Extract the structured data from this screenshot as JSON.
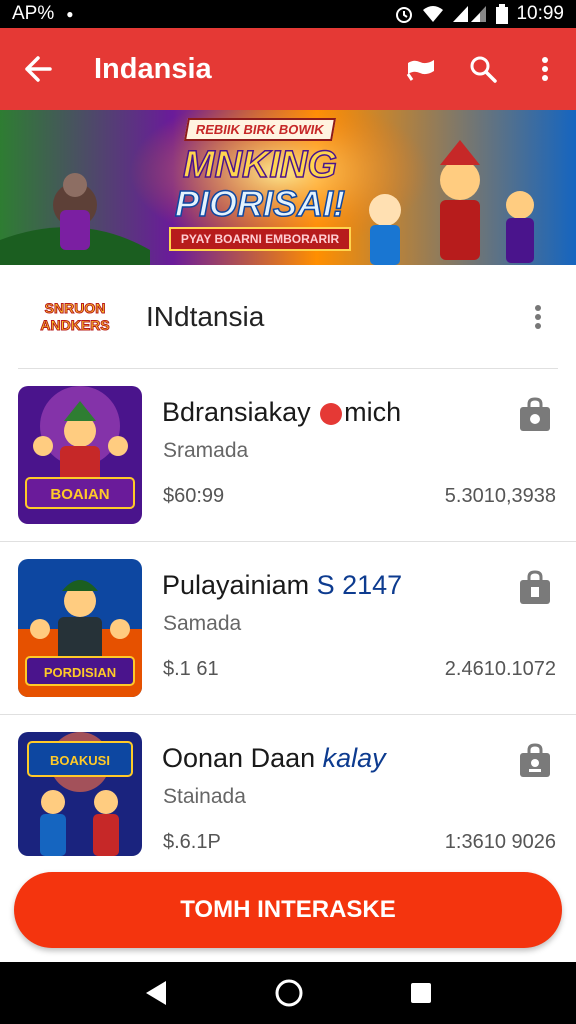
{
  "status_bar": {
    "left_text": "AP%",
    "time": "10:99"
  },
  "app_bar": {
    "title": "Indansia"
  },
  "banner": {
    "top_tag": "REBIIK BIRK BOWIK",
    "headline": "MNKING",
    "subline": "PIORISAI!",
    "ribbon": "PYAY BOARNI EMBORARIR"
  },
  "section": {
    "logo_line1": "SNRUON",
    "logo_line2": "ANDKERS",
    "title": "INdtansia"
  },
  "items": [
    {
      "title_main": "Bdransiakay",
      "title_extra": "mich",
      "subtitle": "Sramada",
      "price": "$60:99",
      "value": "5.3010,3938",
      "thumb_text": "BOAIAN"
    },
    {
      "title_main": "Pulayainiam",
      "title_extra": "S 2147",
      "subtitle": "Samada",
      "price": "$.1 61",
      "value": "2.4610.1072",
      "thumb_text": "PORDISIAN"
    },
    {
      "title_main": "Oonan Daan",
      "title_extra": "kalay",
      "subtitle": "Stainada",
      "price": "$.6.1P",
      "value": "1:3610 9026",
      "thumb_text": "BOAKUSI"
    }
  ],
  "cta": {
    "label": "TOMH INTERASKE"
  },
  "colors": {
    "app_bar": "#e53935",
    "cta": "#f4340e",
    "accent_blue": "#0d3b8f"
  },
  "icons": [
    "back-arrow-icon",
    "label-icon",
    "search-icon",
    "more-vert-icon",
    "shopping-bag-icon",
    "back-nav-icon",
    "home-nav-icon",
    "recents-nav-icon"
  ]
}
